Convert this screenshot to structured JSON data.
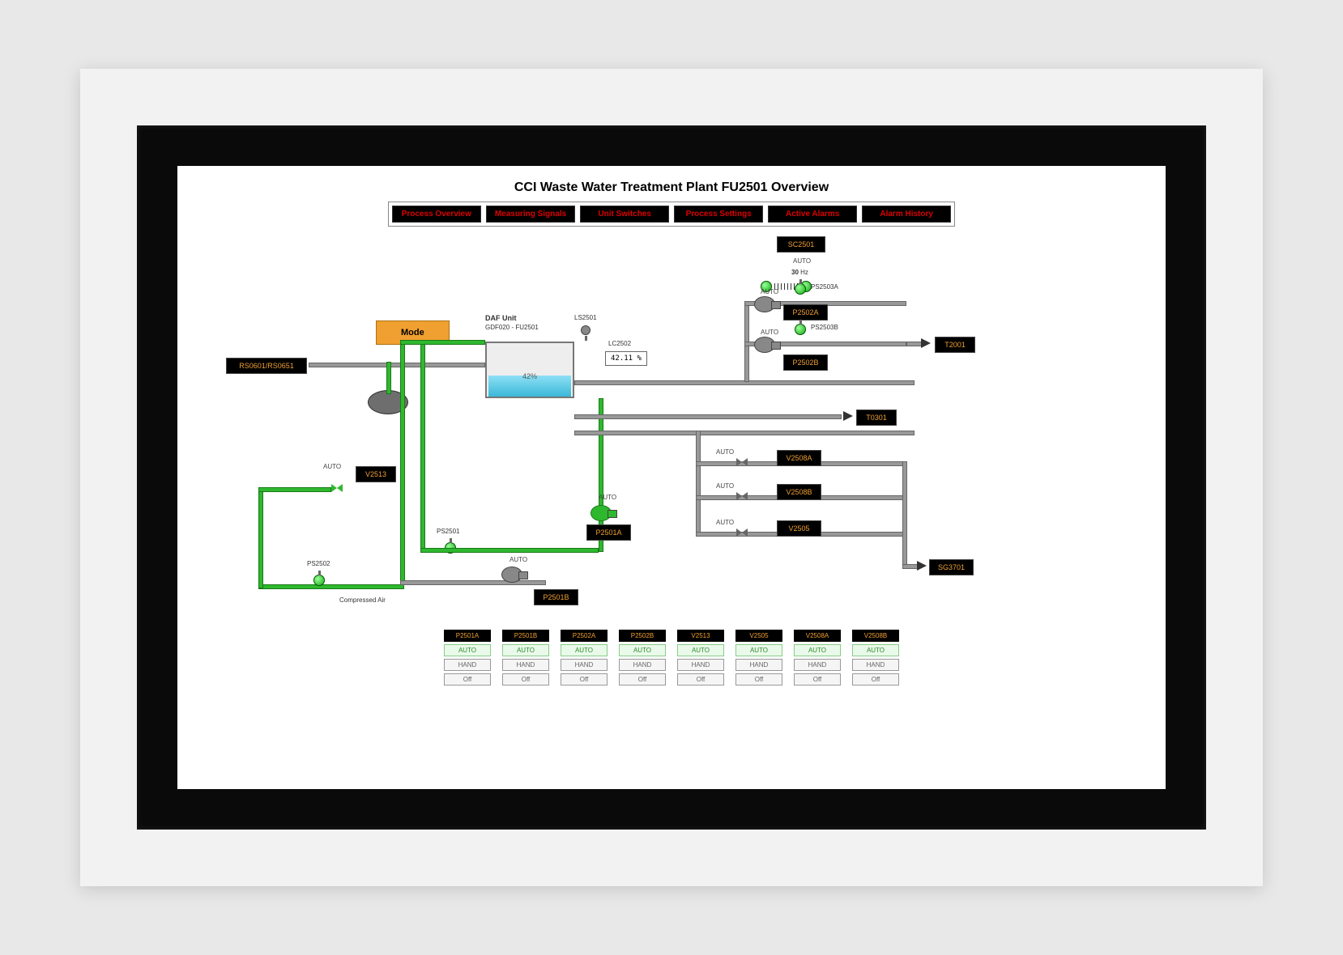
{
  "title": "CCI Waste Water Treatment Plant FU2501 Overview",
  "nav": [
    "Process Overview",
    "Measuring Signals",
    "Unit Switches",
    "Process Settings",
    "Active Alarms",
    "Alarm History"
  ],
  "mode_label": "Mode",
  "daf": {
    "heading": "DAF Unit",
    "sub": "GDF020 - FU2501",
    "level_pct": "42%"
  },
  "sc2501": {
    "tag": "SC2501",
    "mode": "AUTO",
    "freq": "30",
    "unit": "Hz"
  },
  "lc2502": {
    "label": "LC2502",
    "value": "42.11",
    "unit": "%"
  },
  "ls2501": "LS2501",
  "inlet": "RS0601/RS0651",
  "outlets": {
    "t2001": "T2001",
    "t0301": "T0301",
    "sg3701": "SG3701"
  },
  "pumps": {
    "p2502a": {
      "tag": "P2502A",
      "mode": "AUTO",
      "sensor": "PS2503A"
    },
    "p2502b": {
      "tag": "P2502B",
      "mode": "AUTO",
      "sensor": "PS2503B"
    },
    "p2501a": {
      "tag": "P2501A",
      "mode": "AUTO"
    },
    "p2501b": {
      "tag": "P2501B",
      "mode": "AUTO"
    }
  },
  "valves": {
    "v2513": {
      "tag": "V2513",
      "mode": "AUTO"
    },
    "v2508a": {
      "tag": "V2508A",
      "mode": "AUTO"
    },
    "v2508b": {
      "tag": "V2508B",
      "mode": "AUTO"
    },
    "v2505": {
      "tag": "V2505",
      "mode": "AUTO"
    }
  },
  "ps2501": "PS2501",
  "ps2502": "PS2502",
  "compressed_air": "Compressed Air",
  "controls": [
    {
      "tag": "P2501A",
      "auto": "AUTO",
      "hand": "HAND",
      "off": "Off"
    },
    {
      "tag": "P2501B",
      "auto": "AUTO",
      "hand": "HAND",
      "off": "Off"
    },
    {
      "tag": "P2502A",
      "auto": "AUTO",
      "hand": "HAND",
      "off": "Off"
    },
    {
      "tag": "P2502B",
      "auto": "AUTO",
      "hand": "HAND",
      "off": "Off"
    },
    {
      "tag": "V2513",
      "auto": "AUTO",
      "hand": "HAND",
      "off": "Off"
    },
    {
      "tag": "V2505",
      "auto": "AUTO",
      "hand": "HAND",
      "off": "Off"
    },
    {
      "tag": "V2508A",
      "auto": "AUTO",
      "hand": "HAND",
      "off": "Off"
    },
    {
      "tag": "V2508B",
      "auto": "AUTO",
      "hand": "HAND",
      "off": "Off"
    }
  ]
}
